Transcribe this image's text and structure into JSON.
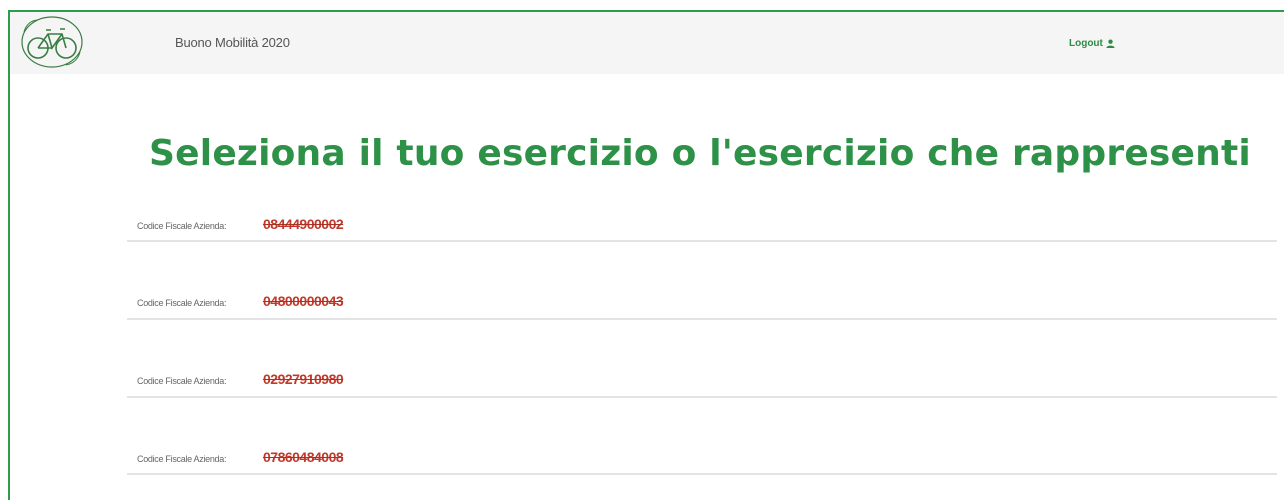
{
  "navbar": {
    "logo_icon": "bicycle-logo-icon",
    "brand": "Buono Mobilità 2020",
    "logout_label": "Logout",
    "logout_icon": "user-icon"
  },
  "page": {
    "title": "Seleziona il tuo esercizio o l'esercizio che rappresenti"
  },
  "businesses": [
    {
      "label": "Codice Fiscale Azienda:",
      "value": "08444900002"
    },
    {
      "label": "Codice Fiscale Azienda:",
      "value": "04800000043"
    },
    {
      "label": "Codice Fiscale Azienda:",
      "value": "02927910980"
    },
    {
      "label": "Codice Fiscale Azienda:",
      "value": "07860484008"
    }
  ],
  "colors": {
    "accent": "#2e9148",
    "redacted": "#c0392b"
  }
}
